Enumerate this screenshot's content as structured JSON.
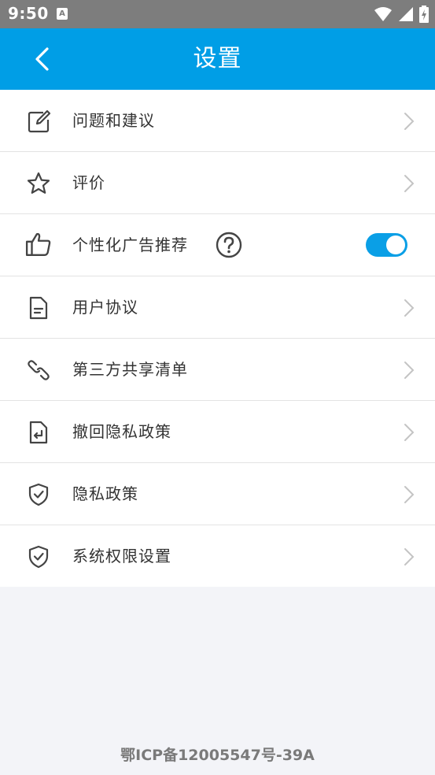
{
  "status_bar": {
    "time": "9:50",
    "notification_letter": "A",
    "icons": [
      "wifi-icon",
      "signal-icon",
      "battery-charging-icon"
    ]
  },
  "app_bar": {
    "title": "设置",
    "back_icon": "chevron-left-icon",
    "color": "#009ee6"
  },
  "settings": {
    "items": [
      {
        "label": "问题和建议",
        "icon": "edit-icon",
        "accessory": "chevron-right"
      },
      {
        "label": "评价",
        "icon": "star-icon",
        "accessory": "chevron-right"
      },
      {
        "label": "个性化广告推荐",
        "icon": "thumbs-up-icon",
        "accessory": "toggle",
        "help_icon": "question-circle-icon",
        "toggle_on": true
      },
      {
        "label": "用户协议",
        "icon": "document-icon",
        "accessory": "chevron-right"
      },
      {
        "label": "第三方共享清单",
        "icon": "link-icon",
        "accessory": "chevron-right"
      },
      {
        "label": "撤回隐私政策",
        "icon": "document-return-icon",
        "accessory": "chevron-right"
      },
      {
        "label": "隐私政策",
        "icon": "shield-check-icon",
        "accessory": "chevron-right"
      },
      {
        "label": "系统权限设置",
        "icon": "shield-check-icon",
        "accessory": "chevron-right"
      }
    ]
  },
  "footer": {
    "icp": "鄂ICP备12005547号-39A"
  },
  "colors": {
    "accent": "#009ee6",
    "toggle_on": "#0a9fe6",
    "background": "#f3f4f8"
  }
}
